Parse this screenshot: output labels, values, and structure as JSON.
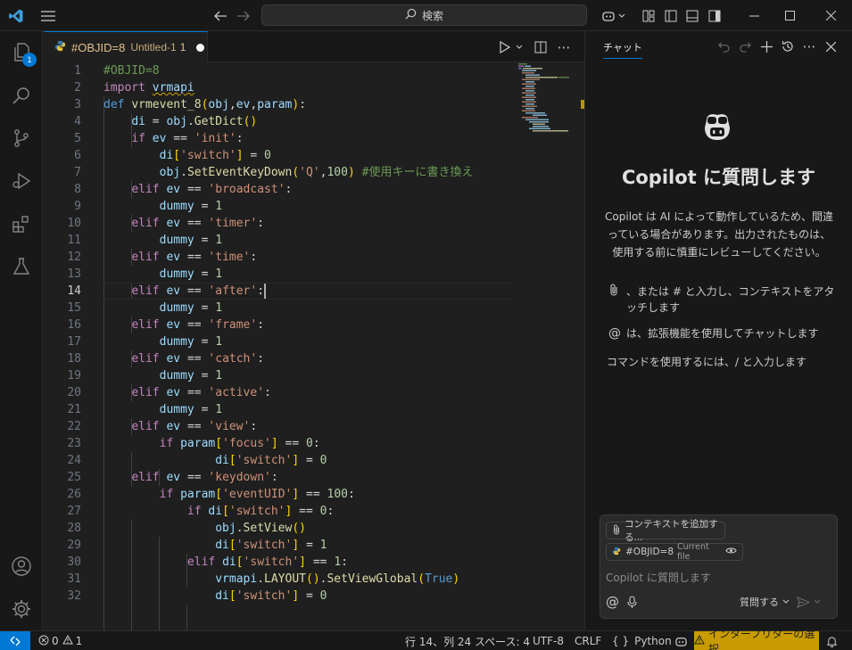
{
  "titlebar": {
    "search_placeholder": "検索",
    "icons": [
      "vscode-logo-icon",
      "menu-icon",
      "back-arrow-icon",
      "forward-arrow-icon",
      "copilot-icon",
      "layout-icons",
      "minimize-icon",
      "maximize-icon",
      "close-icon"
    ]
  },
  "activitybar": {
    "explorer_badge": "1"
  },
  "tab": {
    "title": "#OBJID=8",
    "description": "Untitled-1",
    "problem_count": "1"
  },
  "editor": {
    "active_line": 14,
    "line_numbers": [
      "1",
      "2",
      "3",
      "4",
      "5",
      "6",
      "7",
      "8",
      "9",
      "10",
      "11",
      "12",
      "13",
      "14",
      "15",
      "16",
      "17",
      "18",
      "19",
      "20",
      "21",
      "22",
      "23",
      "24",
      "25",
      "26",
      "27",
      "28",
      "29",
      "30",
      "31",
      "32"
    ]
  },
  "chat": {
    "tab_label": "チャット",
    "title": "Copilot に質問します",
    "description": "Copilot は AI によって動作しているため、間違っている場合があります。出力されたものは、使用する前に慎重にレビューしてください。",
    "tip_attach": "、または # と入力し、コンテキストをアタッチします",
    "tip_extension": "は、拡張機能を使用してチャットします",
    "tip_command": "コマンドを使用するには、/ と入力します",
    "add_context_label": "コンテキストを追加する...",
    "current_file_name": "#OBJID=8",
    "current_file_tag": "Current file",
    "input_placeholder": "Copilot に質問します",
    "ask_label": "質問する"
  },
  "statusbar": {
    "errors": "0",
    "warnings": "1",
    "position": "行 14、列 24",
    "spaces": "スペース: 4",
    "encoding": "UTF-8",
    "eol": "CRLF",
    "language": "Python",
    "interpreter": "インタープリターの選択"
  },
  "colors": {
    "accent": "#0078d4",
    "warning_bg": "#c89c00",
    "background": "#1f1f1f"
  }
}
